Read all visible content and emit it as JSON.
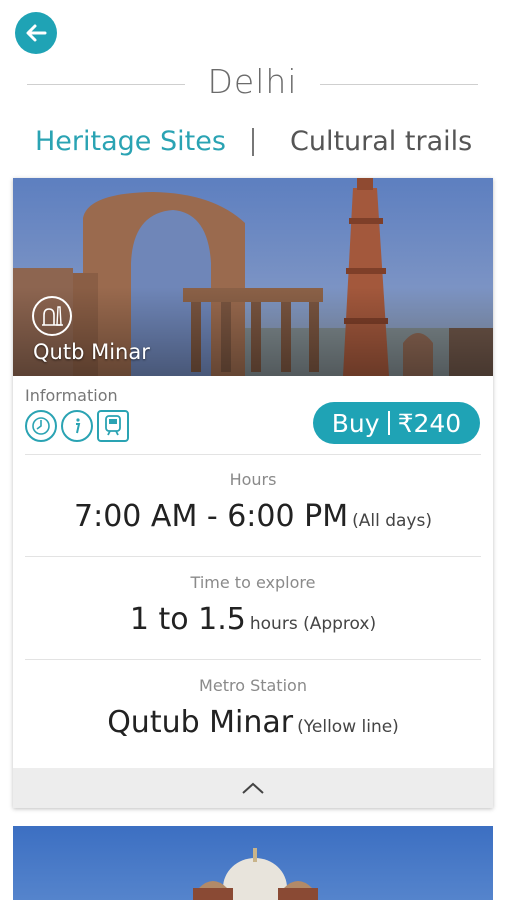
{
  "header": {
    "city": "Delhi"
  },
  "tabs": [
    {
      "label": "Heritage Sites",
      "active": true
    },
    {
      "label": "Cultural trails",
      "active": false
    }
  ],
  "site": {
    "name": "Qutb Minar",
    "info_label": "Information",
    "info_icons": [
      "clock-icon",
      "info-icon",
      "train-icon"
    ],
    "buy": {
      "label": "Buy",
      "currency": "₹",
      "price": "240"
    },
    "details": [
      {
        "label": "Hours",
        "value": "7:00 AM - 6:00 PM",
        "note": "(All days)"
      },
      {
        "label": "Time to explore",
        "value": "1 to 1.5",
        "note": "hours (Approx)"
      },
      {
        "label": "Metro Station",
        "value": "Qutub Minar",
        "note": "(Yellow line)"
      }
    ]
  },
  "colors": {
    "accent": "#1fa3b5",
    "tab_active": "#2aa3b3"
  }
}
